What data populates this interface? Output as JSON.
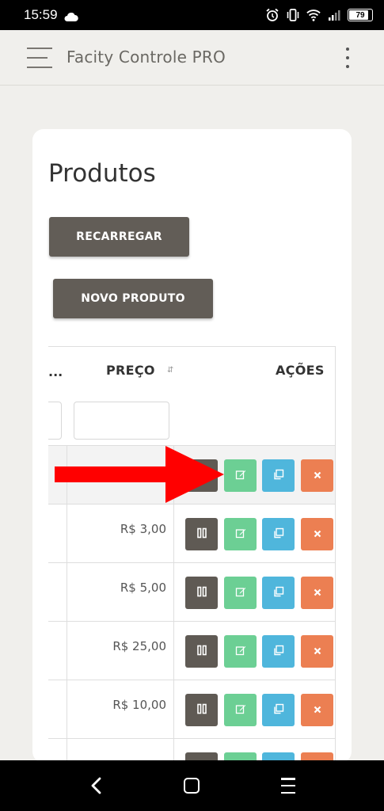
{
  "status_bar": {
    "time": "15:59",
    "battery_level": "79",
    "icons": [
      "cloud-icon",
      "alarm-icon",
      "vibrate-icon",
      "wifi-icon",
      "signal-icon",
      "battery-icon"
    ]
  },
  "app_bar": {
    "title": "Facity Controle PRO",
    "menu_icon": "hamburger-icon",
    "more_icon": "kebab-menu-icon"
  },
  "page": {
    "title": "Produtos",
    "reload_label": "RECARREGAR",
    "new_product_label": "NOVO PRODUTO"
  },
  "table": {
    "columns": [
      "...",
      "PREÇO",
      "AÇÕES"
    ],
    "sort_icon": "sort-icon",
    "filter_price_value": "",
    "rows": [
      {
        "price": ""
      },
      {
        "price": "R$ 3,00"
      },
      {
        "price": "R$ 5,00"
      },
      {
        "price": "R$ 25,00"
      },
      {
        "price": "R$ 10,00"
      },
      {
        "price": ""
      }
    ],
    "action_icons": [
      "pause-icon",
      "edit-icon",
      "copy-icon",
      "delete-icon"
    ]
  },
  "colors": {
    "primary_button": "#625d57",
    "edit": "#6ccf94",
    "copy": "#4fb6dc",
    "delete": "#ec7f52",
    "annotation_arrow": "#ff0000"
  },
  "nav_bar": {
    "icons": [
      "back-icon",
      "home-icon",
      "recent-apps-icon"
    ]
  }
}
